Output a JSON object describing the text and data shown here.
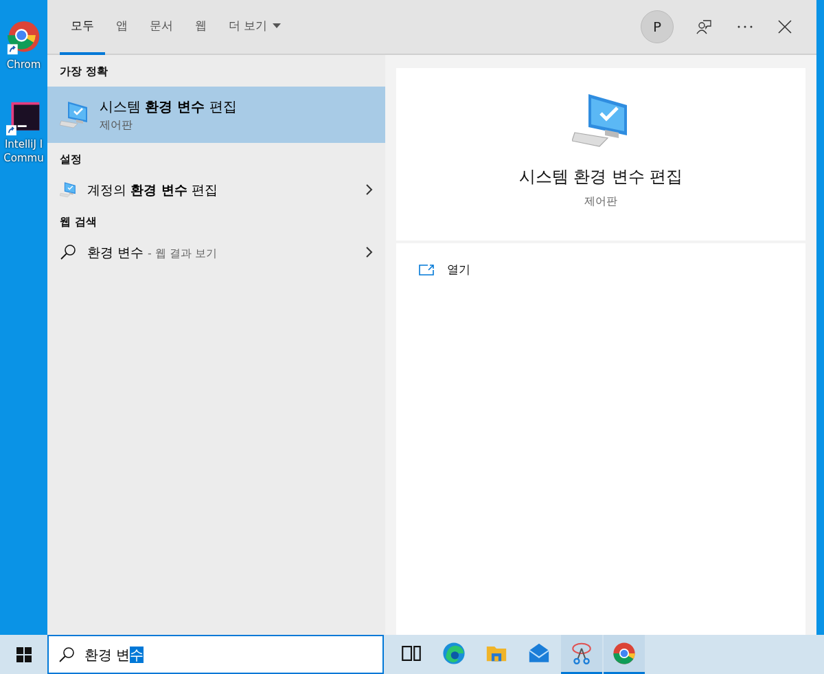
{
  "desktop_icons": [
    {
      "kind": "chrome",
      "label_lines": [
        "Chrom"
      ]
    },
    {
      "kind": "intellij",
      "label_lines": [
        "IntelliJ I",
        "Commu"
      ]
    }
  ],
  "tabs": [
    {
      "label": "모두",
      "selected": true,
      "dropdown": false
    },
    {
      "label": "앱",
      "selected": false,
      "dropdown": false
    },
    {
      "label": "문서",
      "selected": false,
      "dropdown": false
    },
    {
      "label": "웹",
      "selected": false,
      "dropdown": false
    },
    {
      "label": "더 보기",
      "selected": false,
      "dropdown": true
    }
  ],
  "header_actions": {
    "avatar": "P"
  },
  "results": [
    {
      "heading": "가장 정확",
      "items": [
        {
          "kind": "app",
          "title": "시스템 **환경 변수** 편집",
          "subtitle": "제어판",
          "selected": true,
          "chevron": false
        }
      ]
    },
    {
      "heading": "설정",
      "items": [
        {
          "kind": "setting",
          "title": "계정의 **환경 변수** 편집",
          "selected": false,
          "chevron": true
        }
      ]
    },
    {
      "heading": "웹 검색",
      "items": [
        {
          "kind": "web",
          "title": "환경 변수",
          "suffix": "- 웹 결과 보기",
          "selected": false,
          "chevron": true
        }
      ]
    }
  ],
  "preview": {
    "title": "시스템 환경 변수 편집",
    "subtitle": "제어판",
    "actions": [
      {
        "label": "열기"
      }
    ]
  },
  "search_box": {
    "typed": "환경 변",
    "autocompleted": "수"
  },
  "taskbar_apps": [
    {
      "kind": "taskview",
      "running": false
    },
    {
      "kind": "edge",
      "running": false
    },
    {
      "kind": "explorer",
      "running": false
    },
    {
      "kind": "mail",
      "running": false
    },
    {
      "kind": "snip",
      "running": true
    },
    {
      "kind": "chrome",
      "running": true
    }
  ]
}
